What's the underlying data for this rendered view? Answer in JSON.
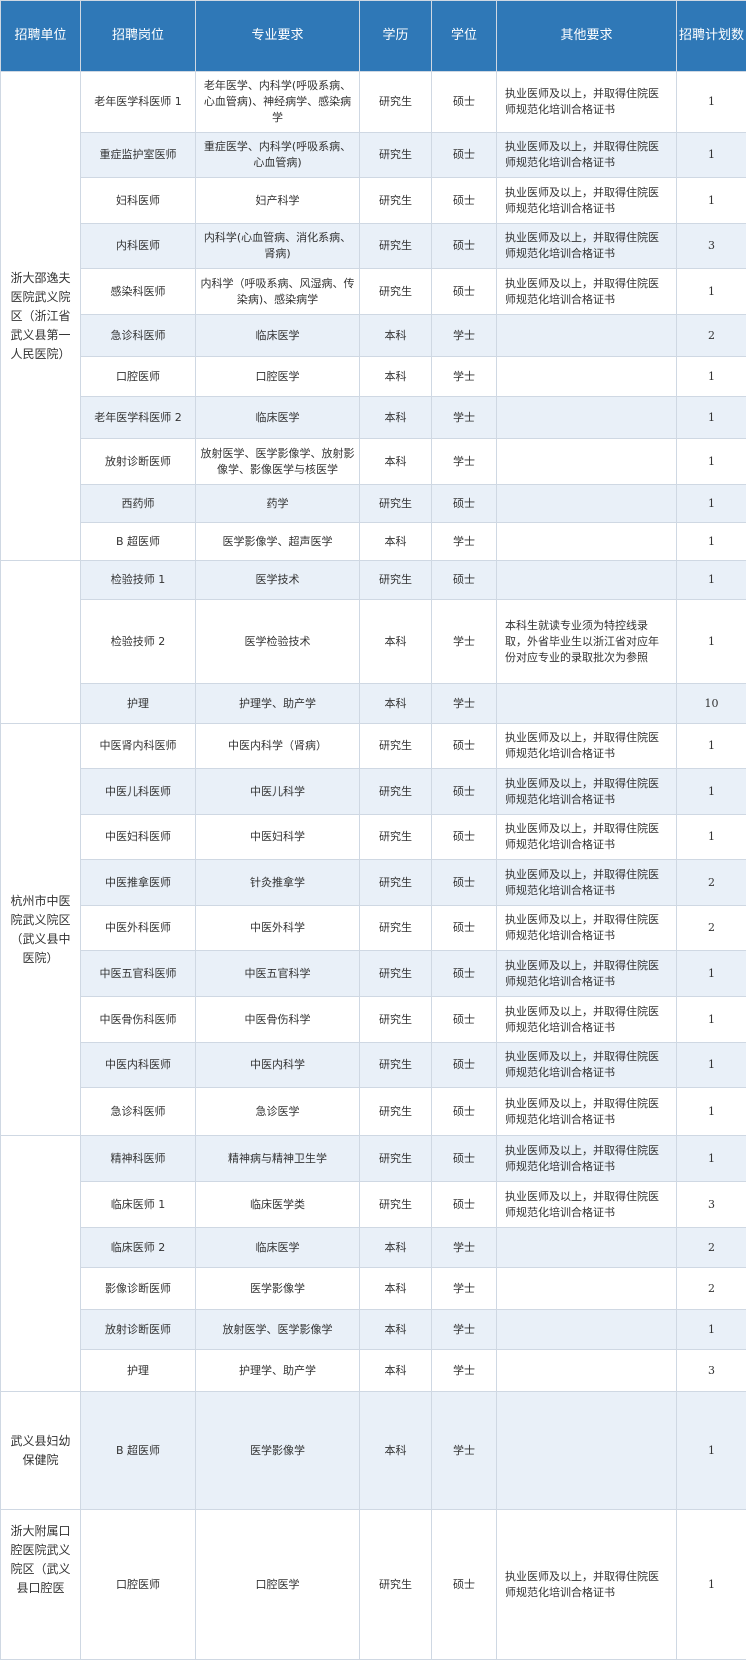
{
  "headers": [
    "招聘单位",
    "招聘岗位",
    "专业要求",
    "学历",
    "学位",
    "其他要求",
    "招聘计划数"
  ],
  "groups": [
    {
      "unit": "浙大邵逸夫医院武义院区（浙江省武义县第一人民医院）",
      "rows": [
        {
          "post": "老年医学科医师 1",
          "major": "老年医学、内科学(呼吸系病、心血管病)、神经病学、感染病学",
          "edu": "研究生",
          "degree": "硕士",
          "other": "执业医师及以上，并取得住院医师规范化培训合格证书",
          "count": "1"
        },
        {
          "post": "重症监护室医师",
          "major": "重症医学、内科学(呼吸系病、心血管病)",
          "edu": "研究生",
          "degree": "硕士",
          "other": "执业医师及以上，并取得住院医师规范化培训合格证书",
          "count": "1"
        },
        {
          "post": "妇科医师",
          "major": "妇产科学",
          "edu": "研究生",
          "degree": "硕士",
          "other": "执业医师及以上，并取得住院医师规范化培训合格证书",
          "count": "1"
        },
        {
          "post": "内科医师",
          "major": "内科学(心血管病、消化系病、肾病)",
          "edu": "研究生",
          "degree": "硕士",
          "other": "执业医师及以上，并取得住院医师规范化培训合格证书",
          "count": "3"
        },
        {
          "post": "感染科医师",
          "major": "内科学（呼吸系病、风湿病、传染病)、感染病学",
          "edu": "研究生",
          "degree": "硕士",
          "other": "执业医师及以上，并取得住院医师规范化培训合格证书",
          "count": "1"
        },
        {
          "post": "急诊科医师",
          "major": "临床医学",
          "edu": "本科",
          "degree": "学士",
          "other": "",
          "count": "2"
        },
        {
          "post": "口腔医师",
          "major": "口腔医学",
          "edu": "本科",
          "degree": "学士",
          "other": "",
          "count": "1"
        },
        {
          "post": "老年医学科医师 2",
          "major": "临床医学",
          "edu": "本科",
          "degree": "学士",
          "other": "",
          "count": "1"
        },
        {
          "post": "放射诊断医师",
          "major": "放射医学、医学影像学、放射影像学、影像医学与核医学",
          "edu": "本科",
          "degree": "学士",
          "other": "",
          "count": "1"
        },
        {
          "post": "西药师",
          "major": "药学",
          "edu": "研究生",
          "degree": "硕士",
          "other": "",
          "count": "1"
        },
        {
          "post": "B 超医师",
          "major": "医学影像学、超声医学",
          "edu": "本科",
          "degree": "学士",
          "other": "",
          "count": "1"
        }
      ]
    },
    {
      "unit": "",
      "rows": [
        {
          "post": "检验技师 1",
          "major": "医学技术",
          "edu": "研究生",
          "degree": "硕士",
          "other": "",
          "count": "1"
        },
        {
          "post": "检验技师 2",
          "major": "医学检验技术",
          "edu": "本科",
          "degree": "学士",
          "other": "本科生就读专业须为特控线录取，外省毕业生以浙江省对应年份对应专业的录取批次为参照",
          "count": "1"
        },
        {
          "post": "护理",
          "major": "护理学、助产学",
          "edu": "本科",
          "degree": "学士",
          "other": "",
          "count": "10"
        }
      ]
    },
    {
      "unit": "杭州市中医院武义院区（武义县中医院）",
      "rows": [
        {
          "post": "中医肾内科医师",
          "major": "中医内科学（肾病）",
          "edu": "研究生",
          "degree": "硕士",
          "other": "执业医师及以上，并取得住院医师规范化培训合格证书",
          "count": "1"
        },
        {
          "post": "中医儿科医师",
          "major": "中医儿科学",
          "edu": "研究生",
          "degree": "硕士",
          "other": "执业医师及以上，并取得住院医师规范化培训合格证书",
          "count": "1"
        },
        {
          "post": "中医妇科医师",
          "major": "中医妇科学",
          "edu": "研究生",
          "degree": "硕士",
          "other": "执业医师及以上，并取得住院医师规范化培训合格证书",
          "count": "1"
        },
        {
          "post": "中医推拿医师",
          "major": "针灸推拿学",
          "edu": "研究生",
          "degree": "硕士",
          "other": "执业医师及以上，并取得住院医师规范化培训合格证书",
          "count": "2"
        },
        {
          "post": "中医外科医师",
          "major": "中医外科学",
          "edu": "研究生",
          "degree": "硕士",
          "other": "执业医师及以上，并取得住院医师规范化培训合格证书",
          "count": "2"
        },
        {
          "post": "中医五官科医师",
          "major": "中医五官科学",
          "edu": "研究生",
          "degree": "硕士",
          "other": "执业医师及以上，并取得住院医师规范化培训合格证书",
          "count": "1"
        },
        {
          "post": "中医骨伤科医师",
          "major": "中医骨伤科学",
          "edu": "研究生",
          "degree": "硕士",
          "other": "执业医师及以上，并取得住院医师规范化培训合格证书",
          "count": "1"
        },
        {
          "post": "中医内科医师",
          "major": "中医内科学",
          "edu": "研究生",
          "degree": "硕士",
          "other": "执业医师及以上，并取得住院医师规范化培训合格证书",
          "count": "1"
        },
        {
          "post": "急诊科医师",
          "major": "急诊医学",
          "edu": "研究生",
          "degree": "硕士",
          "other": "执业医师及以上，并取得住院医师规范化培训合格证书",
          "count": "1"
        }
      ]
    },
    {
      "unit": "",
      "rows": [
        {
          "post": "精神科医师",
          "major": "精神病与精神卫生学",
          "edu": "研究生",
          "degree": "硕士",
          "other": "执业医师及以上，并取得住院医师规范化培训合格证书",
          "count": "1"
        },
        {
          "post": "临床医师 1",
          "major": "临床医学类",
          "edu": "研究生",
          "degree": "硕士",
          "other": "执业医师及以上，并取得住院医师规范化培训合格证书",
          "count": "3"
        },
        {
          "post": "临床医师 2",
          "major": "临床医学",
          "edu": "本科",
          "degree": "学士",
          "other": "",
          "count": "2"
        },
        {
          "post": "影像诊断医师",
          "major": "医学影像学",
          "edu": "本科",
          "degree": "学士",
          "other": "",
          "count": "2"
        },
        {
          "post": "放射诊断医师",
          "major": "放射医学、医学影像学",
          "edu": "本科",
          "degree": "学士",
          "other": "",
          "count": "1"
        },
        {
          "post": "护理",
          "major": "护理学、助产学",
          "edu": "本科",
          "degree": "学士",
          "other": "",
          "count": "3"
        }
      ]
    },
    {
      "unit": "武义县妇幼保健院",
      "rows": [
        {
          "post": "B 超医师",
          "major": "医学影像学",
          "edu": "本科",
          "degree": "学士",
          "other": "",
          "count": "1"
        }
      ]
    },
    {
      "unit": "浙大附属口腔医院武义院区（武义县口腔医",
      "rows": [
        {
          "post": "口腔医师",
          "major": "口腔医学",
          "edu": "研究生",
          "degree": "硕士",
          "other": "执业医师及以上，并取得住院医师规范化培训合格证书",
          "count": "1"
        }
      ]
    }
  ]
}
